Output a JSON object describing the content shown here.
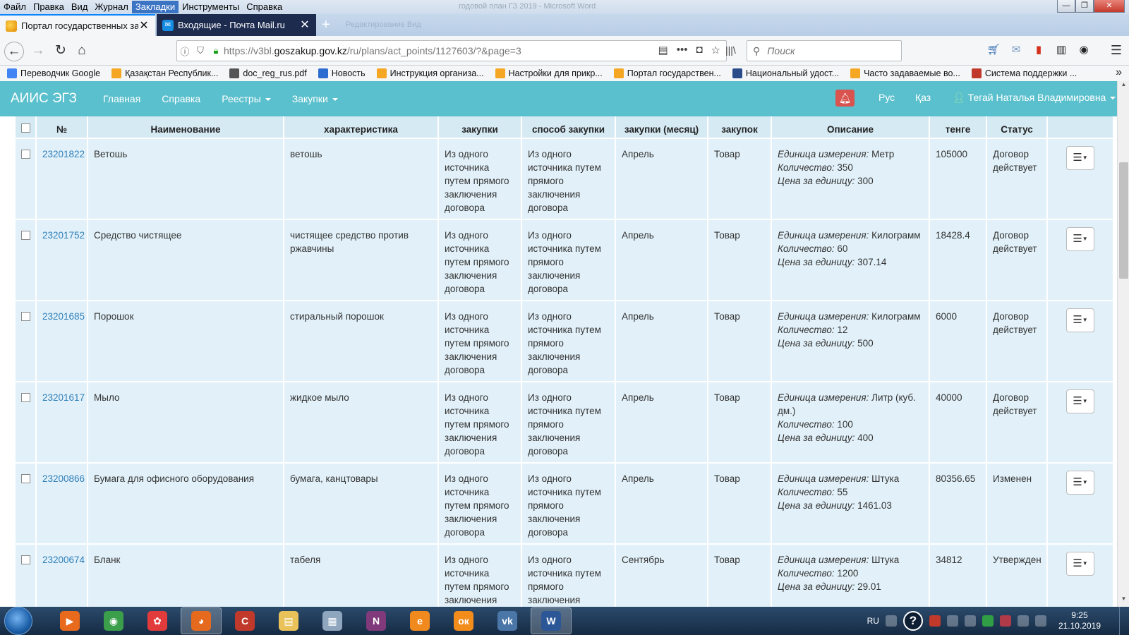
{
  "window": {
    "title": "годовой план ГЗ 2019 - Microsoft Word",
    "menu": [
      "Файл",
      "Правка",
      "Вид",
      "Журнал",
      "Закладки",
      "Инструменты",
      "Справка"
    ],
    "controls": {
      "minimize": "—",
      "maximize": "❐",
      "close": "✕"
    }
  },
  "tabs": [
    {
      "label": "Портал государственных заку",
      "icon": "goszakup-icon",
      "active": true
    },
    {
      "label": "Входящие - Почта Mail.ru",
      "icon": "mail-icon",
      "active": false
    }
  ],
  "ghost_tabs": "Редактирование        Вид",
  "navbar": {
    "url_prefix": "https://v3bl.",
    "url_domain": "goszakup.gov.kz",
    "url_path": "/ru/plans/act_points/1127603/?&page=3",
    "search_placeholder": "Поиск"
  },
  "bookmarks": [
    {
      "label": "Переводчик Google",
      "color": "#4285f4"
    },
    {
      "label": "Қазақстан Республик...",
      "color": "#f5a623"
    },
    {
      "label": "doc_reg_rus.pdf",
      "color": "#555555"
    },
    {
      "label": "Новость",
      "color": "#2c6cd0"
    },
    {
      "label": "Инструкция организа...",
      "color": "#f5a623"
    },
    {
      "label": "Настройки для прикр...",
      "color": "#f5a623"
    },
    {
      "label": "Портал государствен...",
      "color": "#f5a623"
    },
    {
      "label": "Национальный удост...",
      "color": "#2a4d8a"
    },
    {
      "label": "Часто задаваемые во...",
      "color": "#f5a623"
    },
    {
      "label": "Система поддержки ...",
      "color": "#c0392b"
    }
  ],
  "site": {
    "brand": "АИИС ЭГЗ",
    "nav": [
      {
        "label": "Главная",
        "dropdown": false
      },
      {
        "label": "Справка",
        "dropdown": false
      },
      {
        "label": "Реестры",
        "dropdown": true
      },
      {
        "label": "Закупки",
        "dropdown": true
      }
    ],
    "lang_ru": "Рус",
    "lang_kz": "Қаз",
    "user": "Тегай Наталья Владимировна",
    "accent": "#5bc0cd"
  },
  "table": {
    "headers": [
      "",
      "№",
      "Наименование",
      "характеристика",
      "закупки",
      "способ закупки",
      "закупки (месяц)",
      "закупок",
      "Описание",
      "тенге",
      "Статус",
      ""
    ],
    "desc_labels": {
      "unit": "Единица измерения:",
      "qty": "Количество:",
      "price": "Цена за единицу:"
    },
    "rows": [
      {
        "id": "23201822",
        "name": "Ветошь",
        "char": "ветошь",
        "method": "Из одного источника путем прямого заключения договора",
        "method2": "Из одного источника путем прямого заключения договора",
        "month": "Апрель",
        "subject": "Товар",
        "unit": "Метр",
        "qty": "350",
        "price": "300",
        "sum": "105000",
        "status": "Договор действует"
      },
      {
        "id": "23201752",
        "name": "Средство чистящее",
        "char": "чистящее средство против ржавчины",
        "method": "Из одного источника путем прямого заключения договора",
        "method2": "Из одного источника путем прямого заключения договора",
        "month": "Апрель",
        "subject": "Товар",
        "unit": "Килограмм",
        "qty": "60",
        "price": "307.14",
        "sum": "18428.4",
        "status": "Договор действует"
      },
      {
        "id": "23201685",
        "name": "Порошок",
        "char": "стиральный порошок",
        "method": "Из одного источника путем прямого заключения договора",
        "method2": "Из одного источника путем прямого заключения договора",
        "month": "Апрель",
        "subject": "Товар",
        "unit": "Килограмм",
        "qty": "12",
        "price": "500",
        "sum": "6000",
        "status": "Договор действует"
      },
      {
        "id": "23201617",
        "name": "Мыло",
        "char": "жидкое мыло",
        "method": "Из одного источника путем прямого заключения договора",
        "method2": "Из одного источника путем прямого заключения договора",
        "month": "Апрель",
        "subject": "Товар",
        "unit": "Литр (куб. дм.)",
        "qty": "100",
        "price": "400",
        "sum": "40000",
        "status": "Договор действует"
      },
      {
        "id": "23200866",
        "name": "Бумага для офисного оборудования",
        "char": "бумага, канцтовары",
        "method": "Из одного источника путем прямого заключения договора",
        "method2": "Из одного источника путем прямого заключения договора",
        "month": "Апрель",
        "subject": "Товар",
        "unit": "Штука",
        "qty": "55",
        "price": "1461.03",
        "sum": "80356.65",
        "status": "Изменен"
      },
      {
        "id": "23200674",
        "name": "Бланк",
        "char": "табеля",
        "method": "Из одного источника путем прямого заключения договора",
        "method2": "Из одного источника путем прямого заключения договора",
        "month": "Сентябрь",
        "subject": "Товар",
        "unit": "Штука",
        "qty": "1200",
        "price": "29.01",
        "sum": "34812",
        "status": "Утвержден"
      }
    ]
  },
  "taskbar": {
    "apps": [
      {
        "name": "media-player-icon",
        "label": "▶",
        "color": "#e86a1c"
      },
      {
        "name": "chrome-icon",
        "label": "◉",
        "color": "#3a9e4a"
      },
      {
        "name": "paw-app-icon",
        "label": "✿",
        "color": "#e23b3b"
      },
      {
        "name": "firefox-icon",
        "label": "◕",
        "color": "#e66a1e"
      },
      {
        "name": "ccleaner-icon",
        "label": "C",
        "color": "#c0392b"
      },
      {
        "name": "explorer-icon",
        "label": "▤",
        "color": "#e9c25a"
      },
      {
        "name": "calculator-icon",
        "label": "▦",
        "color": "#8fa6bf"
      },
      {
        "name": "onenote-icon",
        "label": "N",
        "color": "#80397b"
      },
      {
        "name": "edge-icon",
        "label": "e",
        "color": "#f08a1f"
      },
      {
        "name": "odnoklassniki-icon",
        "label": "ок",
        "color": "#f28c1b"
      },
      {
        "name": "vk-icon",
        "label": "vk",
        "color": "#4a76a8"
      },
      {
        "name": "word-icon",
        "label": "W",
        "color": "#2b5797"
      }
    ],
    "lang": "RU",
    "time": "9:25",
    "date": "21.10.2019"
  }
}
